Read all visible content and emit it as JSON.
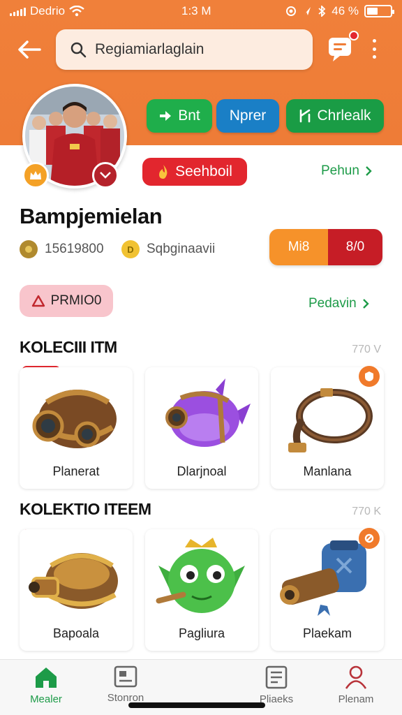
{
  "status_bar": {
    "carrier": "Dedrio",
    "time": "1:3 M",
    "battery_percent": "46 %",
    "battery_level": 0.46
  },
  "header": {
    "search_text": "Regiamiarlaglain",
    "action_pills": [
      {
        "label": "Bnt",
        "color": "#1fae4b",
        "icon": "arrow-right-icon"
      },
      {
        "label": "Nprer",
        "color": "#1a7fc6",
        "icon": ""
      },
      {
        "label": "Chrlealk",
        "color": "#1a9c45",
        "icon": "lightning-icon"
      }
    ]
  },
  "profile": {
    "badge_label": "Seehboil",
    "link_top": "Pehun",
    "name": "Bampjemielan",
    "stat_1": "15619800",
    "stat_2": "Sqbginaavii",
    "coin_2_letter": "D",
    "segment_a": "Mi8",
    "segment_b": "8/0",
    "promo_label": "PRMIO0",
    "link_bottom": "Pedavin"
  },
  "sections": [
    {
      "title": "KOLECIII ITM",
      "count": "770 V",
      "items": [
        {
          "label": "Planerat",
          "icon": "barrel-cannon-icon"
        },
        {
          "label": "Dlarjnoal",
          "icon": "purple-fish-icon"
        },
        {
          "label": "Manlana",
          "icon": "rope-whip-icon"
        }
      ]
    },
    {
      "title": "KOLEKTIO ITEEM",
      "count": "770 K",
      "items": [
        {
          "label": "Bapoala",
          "icon": "golden-cannon-icon"
        },
        {
          "label": "Pagliura",
          "icon": "green-creature-icon"
        },
        {
          "label": "Plaekam",
          "icon": "blue-cannon-icon"
        }
      ]
    }
  ],
  "bottom_nav": [
    {
      "label": "Mealer",
      "icon": "home-icon",
      "active": true
    },
    {
      "label": "Stonron",
      "icon": "image-card-icon",
      "active": false
    },
    {
      "label": "Pliaeks",
      "icon": "document-list-icon",
      "active": false
    },
    {
      "label": "Plenam",
      "icon": "person-icon",
      "active": false
    }
  ],
  "colors": {
    "header_orange": "#ef7d37",
    "accent_green": "#1d9b48",
    "accent_red": "#e2262e"
  }
}
